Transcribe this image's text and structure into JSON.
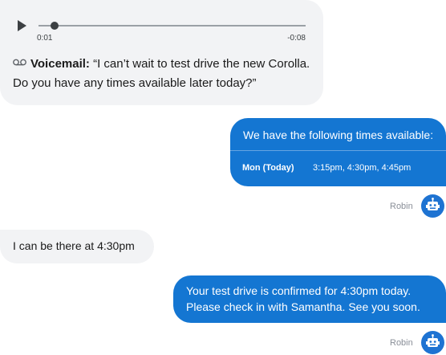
{
  "voicemail": {
    "time_elapsed": "0:01",
    "time_remaining": "-0:08",
    "progress": 0.06,
    "label": "Voicemail:",
    "transcript": " “I can’t wait to test drive the new Corolla. Do you have any times available later today?”"
  },
  "times_message": {
    "heading": "We have the following times available:",
    "day": "Mon (Today)",
    "slots": "3:15pm, 4:30pm, 4:45pm"
  },
  "agent": {
    "name": "Robin",
    "color": "#1e73d2"
  },
  "customer_reply": "I can be there at 4:30pm",
  "confirm_message": "Your test drive is confirmed for 4:30pm today. Please check in with Samantha. See you soon.",
  "colors": {
    "outgoing": "#1476d2",
    "incoming": "#f2f3f5"
  }
}
